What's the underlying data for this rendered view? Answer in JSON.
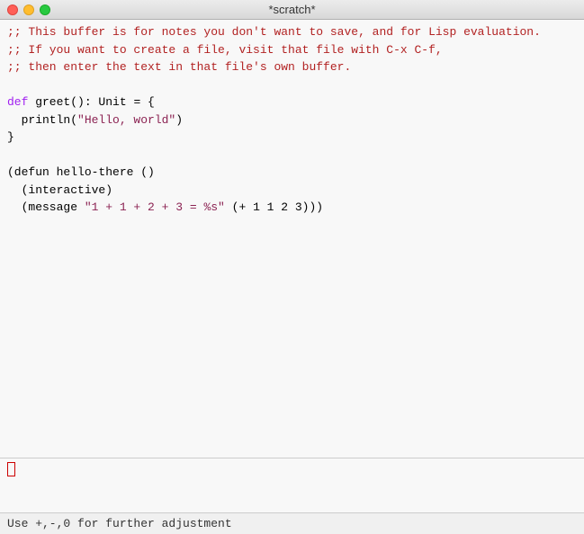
{
  "window": {
    "title": "*scratch*"
  },
  "controls": {
    "close_label": "",
    "minimize_label": "",
    "maximize_label": ""
  },
  "editor": {
    "lines": [
      {
        "id": "line1",
        "type": "comment",
        "text": ";; This buffer is for notes you don't want to save, and for Lisp evaluation."
      },
      {
        "id": "line2",
        "type": "comment",
        "text": ";; If you want to create a file, visit that file with C-x C-f,"
      },
      {
        "id": "line3",
        "type": "comment",
        "text": ";; then enter the text in that file's own buffer."
      },
      {
        "id": "line4",
        "type": "blank",
        "text": ""
      },
      {
        "id": "line5",
        "type": "code",
        "text": "def greet(): Unit = {"
      },
      {
        "id": "line6",
        "type": "code_string",
        "text": "  println(\"Hello, world\")"
      },
      {
        "id": "line7",
        "type": "code",
        "text": "}"
      },
      {
        "id": "line8",
        "type": "blank",
        "text": ""
      },
      {
        "id": "line9",
        "type": "code",
        "text": "(defun hello-there ()"
      },
      {
        "id": "line10",
        "type": "code",
        "text": "  (interactive)"
      },
      {
        "id": "line11",
        "type": "code_string2",
        "text": "  (message \"1 + 1 + 2 + 3 = %s\" (+ 1 1 2 3)))"
      }
    ]
  },
  "minibuffer": {
    "cursor_visible": true
  },
  "status_bar": {
    "text": "Use +,-,0 for further adjustment"
  }
}
